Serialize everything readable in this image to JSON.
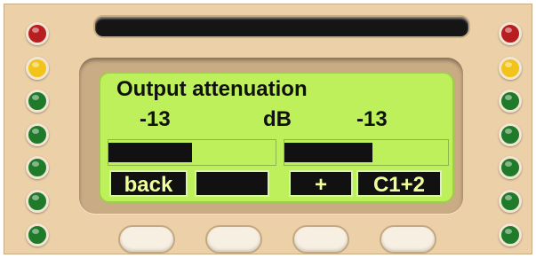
{
  "colors": {
    "body": "#ecd0a8",
    "lcd": "#bef05c",
    "led_red": "#b81e20",
    "led_yellow": "#f2c318",
    "led_green": "#1f7a2a"
  },
  "display": {
    "title": "Output attenuation",
    "left_value": "-13",
    "unit": "dB",
    "right_value": "-13",
    "left_meter_level": 0.5,
    "right_meter_level": 0.54
  },
  "softkeys": {
    "back": "back",
    "blank": "",
    "plus": "+",
    "channel": "C1+2"
  },
  "leds": {
    "left": [
      "red",
      "yellow",
      "green",
      "green",
      "green",
      "green",
      "green"
    ],
    "right": [
      "red",
      "yellow",
      "green",
      "green",
      "green",
      "green",
      "green"
    ]
  }
}
